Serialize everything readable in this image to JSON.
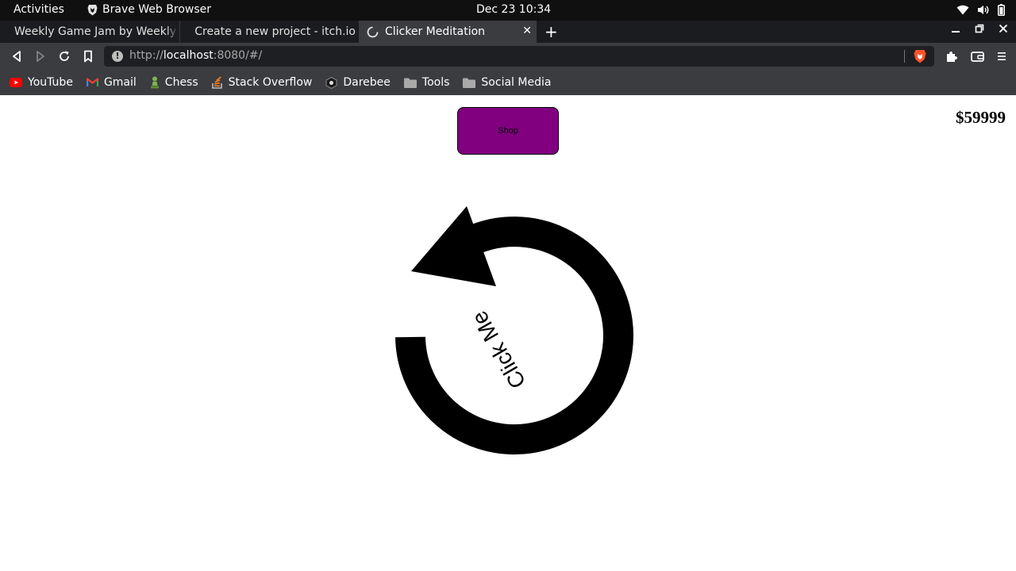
{
  "system": {
    "activities": "Activities",
    "app_name": "Brave Web Browser",
    "clock": "Dec 23  10:34"
  },
  "tabs": [
    {
      "label": "Weekly Game Jam by Weekly Game Jam"
    },
    {
      "label": "Create a new project - itch.io"
    },
    {
      "label": "Clicker Meditation"
    }
  ],
  "address": {
    "scheme": "http://",
    "host": "localhost",
    "rest": ":8080/#/"
  },
  "bookmarks": [
    {
      "label": "YouTube"
    },
    {
      "label": "Gmail"
    },
    {
      "label": "Chess"
    },
    {
      "label": "Stack Overflow"
    },
    {
      "label": "Darebee"
    },
    {
      "label": "Tools"
    },
    {
      "label": "Social Media"
    }
  ],
  "page": {
    "shop_label": "Shop",
    "money": "$59999",
    "click_label": "Click Me"
  },
  "colors": {
    "shop_button": "#800080"
  }
}
